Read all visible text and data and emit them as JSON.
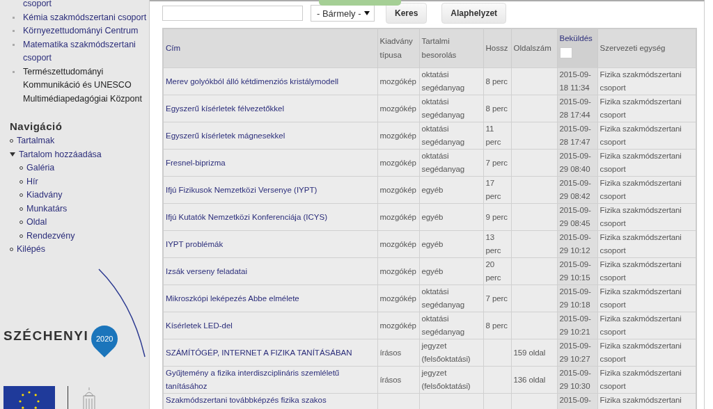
{
  "sidebar": {
    "groups": [
      {
        "label": "csoport",
        "kind": "continuation",
        "active": false
      },
      {
        "label": "Kémia szakmódszertani csoport",
        "kind": "item",
        "active": false
      },
      {
        "label": "Környezettudományi Centrum",
        "kind": "item",
        "active": false
      },
      {
        "label": "Matematika szakmódszertani csoport",
        "kind": "item",
        "active": false
      },
      {
        "label": "Természettudományi Kommunikáció és UNESCO Multimédiapedagógiai Központ",
        "kind": "item",
        "active": true
      }
    ],
    "navigation": {
      "title": "Navigáció",
      "items": [
        {
          "label": "Tartalmak",
          "expanded": false
        },
        {
          "label": "Tartalom hozzáadása",
          "expanded": true,
          "children": [
            {
              "label": "Galéria"
            },
            {
              "label": "Hír"
            },
            {
              "label": "Kiadvány"
            },
            {
              "label": "Munkatárs"
            },
            {
              "label": "Oldal"
            },
            {
              "label": "Rendezvény"
            }
          ]
        },
        {
          "label": "Kilépés",
          "expanded": false
        }
      ]
    },
    "logo": {
      "name": "SZÉCHENYI",
      "year": "2020"
    }
  },
  "filters": {
    "type_select": {
      "value": "- Bármely -"
    },
    "buttons": [
      "Keres",
      "Alaphelyzet"
    ]
  },
  "table": {
    "columns": [
      {
        "label": "Cím",
        "sortable": true,
        "sorted": false
      },
      {
        "label": "Kiadvány típusa",
        "sortable": false,
        "sorted": false
      },
      {
        "label": "Tartalmi besorolás",
        "sortable": false,
        "sorted": false
      },
      {
        "label": "Hossz",
        "sortable": false,
        "sorted": false
      },
      {
        "label": "Oldalszám",
        "sortable": false,
        "sorted": false
      },
      {
        "label": "Beküldés",
        "sortable": true,
        "sorted": true
      },
      {
        "label": "Szervezeti egység",
        "sortable": false,
        "sorted": false
      }
    ],
    "rows": [
      {
        "title": "Merev golyókból álló kétdimenziós kristálymodell",
        "type": "mozgókép",
        "category": "oktatási segédanyag",
        "length": "8 perc",
        "date": "2015-09-18 11:34",
        "unit": "Fizika szakmódszertani csoport"
      },
      {
        "title": "Egyszerű kísérletek félvezetőkkel",
        "type": "mozgókép",
        "category": "oktatási segédanyag",
        "length": "8 perc",
        "date": "2015-09-28 17:44",
        "unit": "Fizika szakmódszertani csoport"
      },
      {
        "title": "Egyszerű kísérletek mágnesekkel",
        "type": "mozgókép",
        "category": "oktatási segédanyag",
        "length": "11 perc",
        "date": "2015-09-28 17:47",
        "unit": "Fizika szakmódszertani csoport"
      },
      {
        "title": "Fresnel-biprizma",
        "type": "mozgókép",
        "category": "oktatási segédanyag",
        "length": "7 perc",
        "date": "2015-09-29 08:40",
        "unit": "Fizika szakmódszertani csoport"
      },
      {
        "title": "Ifjú Fizikusok Nemzetközi Versenye (IYPT)",
        "type": "mozgókép",
        "category": "egyéb",
        "length": "17 perc",
        "date": "2015-09-29 08:42",
        "unit": "Fizika szakmódszertani csoport"
      },
      {
        "title": "Ifjú Kutatók Nemzetközi Konferenciája (ICYS)",
        "type": "mozgókép",
        "category": "egyéb",
        "length": "9 perc",
        "date": "2015-09-29 08:45",
        "unit": "Fizika szakmódszertani csoport"
      },
      {
        "title": "IYPT problémák",
        "type": "mozgókép",
        "category": "egyéb",
        "length": "13 perc",
        "date": "2015-09-29 10:12",
        "unit": "Fizika szakmódszertani csoport"
      },
      {
        "title": "Izsák verseny feladatai",
        "type": "mozgókép",
        "category": "egyéb",
        "length": "20 perc",
        "date": "2015-09-29 10:15",
        "unit": "Fizika szakmódszertani csoport"
      },
      {
        "title": "Mikroszkópi leképezés Abbe elmélete",
        "type": "mozgókép",
        "category": "oktatási segédanyag",
        "length": "7 perc",
        "date": "2015-09-29 10:18",
        "unit": "Fizika szakmódszertani csoport"
      },
      {
        "title": "Kísérletek LED-del",
        "type": "mozgókép",
        "category": "oktatási segédanyag",
        "length": "8 perc",
        "date": "2015-09-29 10:21",
        "unit": "Fizika szakmódszertani csoport"
      },
      {
        "title": "SZÁMÍTÓGÉP, INTERNET A FIZIKA TANÍTÁSÁBAN",
        "type": "írásos",
        "category": "jegyzet (felsőoktatási)",
        "pages": "159 oldal",
        "date": "2015-09-29 10:27",
        "unit": "Fizika szakmódszertani csoport"
      },
      {
        "title": "Gyűjtemény a fizika interdiszciplináris szemléletű tanításához",
        "type": "írásos",
        "category": "jegyzet (felsőoktatási)",
        "pages": "136 oldal",
        "date": "2015-09-29 10:30",
        "unit": "Fizika szakmódszertani csoport"
      },
      {
        "title": "Szakmódszertani továbbképzés fizika szakos",
        "date": "2015-09-",
        "unit": "Fizika szakmódszertani"
      }
    ]
  }
}
